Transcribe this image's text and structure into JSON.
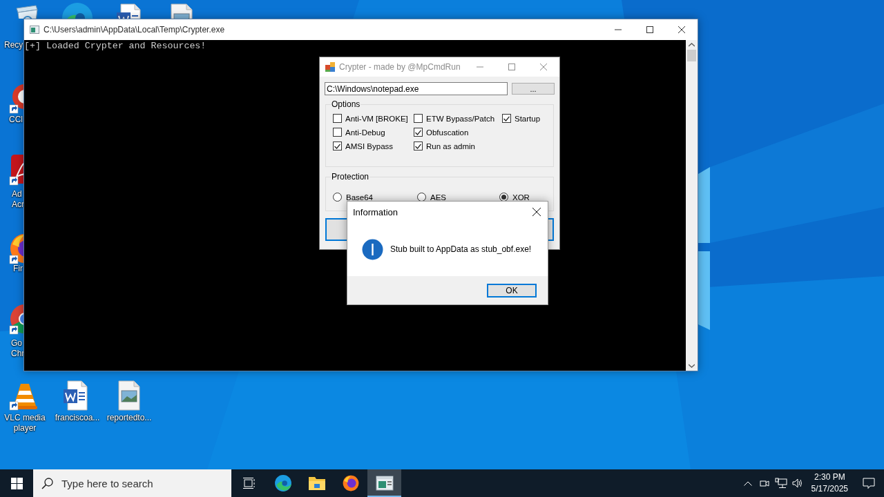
{
  "desktop": {
    "icons": [
      {
        "kind": "recycle-bin",
        "label": [
          "Recy"
        ]
      },
      {
        "kind": "edge"
      },
      {
        "kind": "word-doc"
      },
      {
        "kind": "image-doc"
      },
      {
        "kind": "ccleaner",
        "label": [
          "CCl"
        ]
      },
      {
        "kind": "acrobat",
        "label": [
          "Ad",
          "Acr"
        ]
      },
      {
        "kind": "firefox",
        "label": [
          "Fir"
        ]
      },
      {
        "kind": "chrome",
        "label": [
          "Go",
          "Chr"
        ]
      },
      {
        "kind": "vlc",
        "label": [
          "VLC media",
          "player"
        ]
      },
      {
        "kind": "word-doc",
        "label": [
          "franciscoa..."
        ]
      },
      {
        "kind": "image-doc",
        "label": [
          "reportedto..."
        ]
      }
    ]
  },
  "console_window": {
    "title": "C:\\Users\\admin\\AppData\\Local\\Temp\\Crypter.exe",
    "lines": [
      "[+] Loaded Crypter and Resources!"
    ]
  },
  "crypter_window": {
    "title": "Crypter - made by @MpCmdRun",
    "path_field": {
      "value": "C:\\Windows\\notepad.exe"
    },
    "browse_button": "...",
    "options": {
      "title": "Options",
      "columns": [
        [
          {
            "label": "Anti-VM [BROKE]",
            "checked": false
          },
          {
            "label": "Anti-Debug",
            "checked": false
          },
          {
            "label": "AMSI Bypass",
            "checked": true
          }
        ],
        [
          {
            "label": "ETW Bypass/Patch",
            "checked": false
          },
          {
            "label": "Obfuscation",
            "checked": true
          },
          {
            "label": "Run as admin",
            "checked": true
          }
        ],
        [
          {
            "label": "Startup",
            "checked": true
          }
        ]
      ]
    },
    "protection": {
      "title": "Protection",
      "choices": [
        {
          "label": "Base64",
          "selected": false
        },
        {
          "label": "AES",
          "selected": false
        },
        {
          "label": "XOR",
          "selected": true
        }
      ]
    }
  },
  "info_dialog": {
    "title": "Information",
    "message": "Stub built to AppData as stub_obf.exe!",
    "button": "OK"
  },
  "taskbar": {
    "search": {
      "placeholder": "Type here to search"
    },
    "apps": [
      {
        "kind": "edge",
        "selected": false
      },
      {
        "kind": "explorer",
        "selected": false
      },
      {
        "kind": "firefox",
        "selected": false
      },
      {
        "kind": "console",
        "selected": true
      }
    ],
    "clock": {
      "time": "2:30 PM",
      "date": "5/17/2025"
    }
  }
}
